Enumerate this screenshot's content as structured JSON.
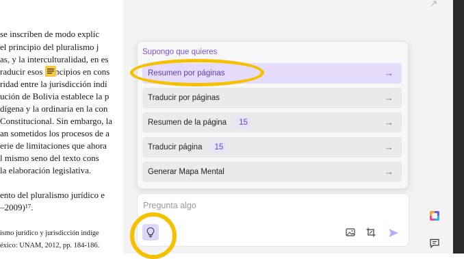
{
  "document": {
    "lines": [
      "",
      "se inscriben de modo explíc",
      "el principio del pluralismo j",
      "as, y la interculturalidad, en es",
      "raducir esos principios en cons",
      "ridad entre la jurisdicción indí",
      "ución de Bolivia establece la p",
      "dígena y la ordinaria en la con",
      "Constitucional. Sin embargo, la",
      "an sometidos los procesos de a",
      "erie de limitaciones que ahora",
      "l mismo seno del texto cons",
      "la elaboración legislativa.",
      "ento del pluralismo jurídico e",
      "–2009)¹⁷.",
      "ismo jurídico y jurisdicción indíge",
      "éxico: UNAM, 2012, pp. 184-186."
    ]
  },
  "popup": {
    "title": "Supongo que quieres",
    "options": [
      {
        "label": "Resumen por páginas",
        "badge": "",
        "arrow": "→"
      },
      {
        "label": "Traducir por páginas",
        "badge": "",
        "arrow": "→"
      },
      {
        "label": "Resumen de la página",
        "badge": "15",
        "arrow": "→"
      },
      {
        "label": "Traducir página",
        "badge": "15",
        "arrow": "→"
      },
      {
        "label": "Generar Mapa Mental",
        "badge": "",
        "arrow": "→"
      }
    ]
  },
  "input": {
    "placeholder": "Pregunta algo"
  },
  "icons": {
    "note": "comment-note-icon",
    "bulb": "lightbulb-icon",
    "image": "image-icon",
    "crop": "crop-icon",
    "send": "send-icon",
    "app": "app-logo-icon",
    "chat": "chat-icon"
  },
  "colors": {
    "accent": "#7b52d9",
    "highlight": "#f5c000",
    "active_bg": "#e4dcfa"
  }
}
